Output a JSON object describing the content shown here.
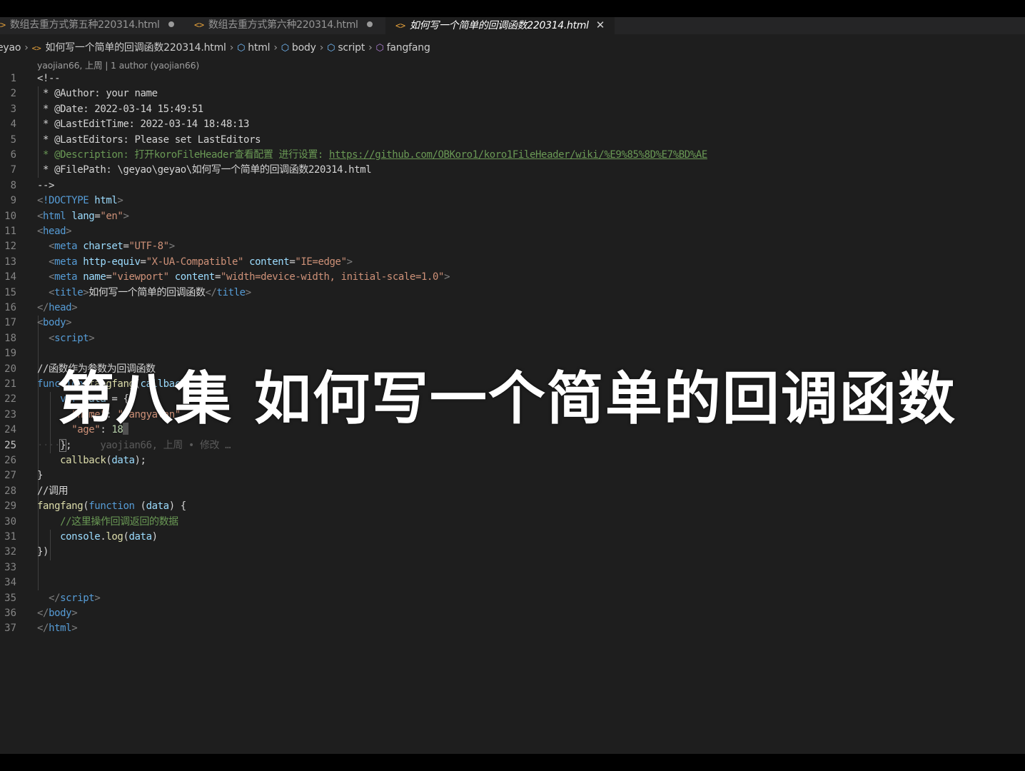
{
  "tabs": [
    {
      "label": "数组去重方式第五种220314.html",
      "modified": true
    },
    {
      "label": "数组去重方式第六种220314.html",
      "modified": true
    },
    {
      "label": "如何写一个简单的回调函数220314.html",
      "active": true
    }
  ],
  "breadcrumb": {
    "root": "eyao",
    "file": "如何写一个简单的回调函数220314.html",
    "items": [
      "html",
      "body",
      "script",
      "fangfang"
    ]
  },
  "blame_header": "yaojian66, 上周 | 1 author (yaojian66)",
  "inline_blame": "yaojian66, 上周 • 修改 …",
  "overlay_title": "第八集 如何写一个简单的回调函数",
  "cursor_line": 25,
  "line_numbers": [
    "1",
    "2",
    "3",
    "4",
    "5",
    "6",
    "7",
    "8",
    "9",
    "10",
    "11",
    "12",
    "13",
    "14",
    "15",
    "16",
    "17",
    "18",
    "19",
    "20",
    "21",
    "22",
    "23",
    "24",
    "25",
    "26",
    "27",
    "28",
    "29",
    "30",
    "31",
    "32",
    "33",
    "34",
    "35",
    "36",
    "37"
  ],
  "code": {
    "l1": "<!--",
    "l2": " * @Author: your name",
    "l3": " * @Date: 2022-03-14 15:49:51",
    "l4": " * @LastEditTime: 2022-03-14 18:48:13",
    "l5": " * @LastEditors: Please set LastEditors",
    "l6_pre": " * @Description: 打开koroFileHeader查看配置 进行设置: ",
    "l6_link": "https://github.com/OBKoro1/koro1FileHeader/wiki/%E9%85%8D%E7%BD%AE",
    "l7": " * @FilePath: \\geyao\\geyao\\如何写一个简单的回调函数220314.html",
    "l8": "-->",
    "doctype_kw": "!DOCTYPE",
    "doctype_val": "html",
    "tag_html": "html",
    "attr_lang": "lang",
    "val_en": "\"en\"",
    "tag_head": "head",
    "tag_meta": "meta",
    "attr_charset": "charset",
    "val_utf8": "\"UTF-8\"",
    "attr_http_equiv": "http-equiv",
    "val_xua": "\"X-UA-Compatible\"",
    "attr_content": "content",
    "val_ie": "\"IE=edge\"",
    "attr_name": "name",
    "val_viewport": "\"viewport\"",
    "val_width": "\"width=device-width, initial-scale=1.0\"",
    "tag_title": "title",
    "title_text": "如何写一个简单的回调函数",
    "tag_body": "body",
    "tag_script": "script",
    "l20": "//函数作为参数为回调函数",
    "kw_function": "function",
    "fn_fangfang": "fangfang",
    "param_callback": "callback",
    "kw_var": "var",
    "var_data": "data",
    "key_name": "\"name\"",
    "val_fangyalan": "\"fangyalan\"",
    "key_age": "\"age\"",
    "num_18": "18",
    "fn_callback": "callback",
    "l28": "//调用",
    "l30": "//这里操作回调返回的数据",
    "obj_console": "console",
    "fn_log": "log"
  }
}
